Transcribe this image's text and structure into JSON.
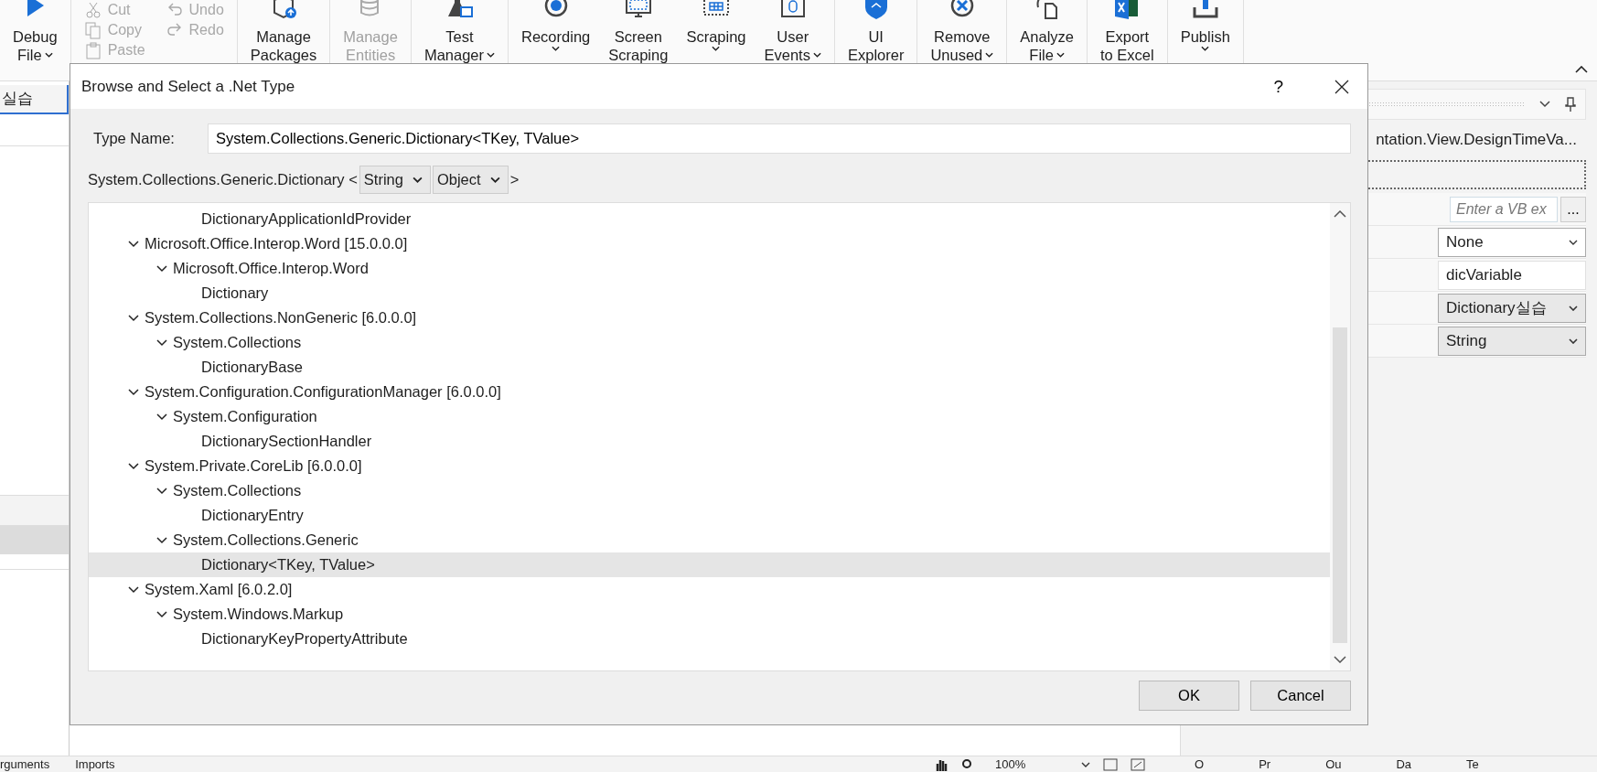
{
  "ribbon": {
    "groups": [
      {
        "kind": "buttons",
        "buttons": [
          {
            "lines": [
              "Debug",
              "File"
            ],
            "dropdown": true,
            "disabled": false
          }
        ]
      },
      {
        "kind": "clipboard",
        "items": [
          {
            "label": "Cut",
            "disabled": true
          },
          {
            "label": "Undo",
            "disabled": true
          },
          {
            "label": "Copy",
            "disabled": true
          },
          {
            "label": "Redo",
            "disabled": true
          },
          {
            "label": "Paste",
            "disabled": true
          }
        ]
      },
      {
        "kind": "buttons",
        "buttons": [
          {
            "lines": [
              "Manage",
              "Packages"
            ],
            "dropdown": false,
            "disabled": false
          }
        ]
      },
      {
        "kind": "buttons",
        "buttons": [
          {
            "lines": [
              "Manage",
              "Entities"
            ],
            "dropdown": false,
            "disabled": true
          }
        ]
      },
      {
        "kind": "buttons",
        "buttons": [
          {
            "lines": [
              "Test",
              "Manager"
            ],
            "dropdown": true,
            "disabled": false
          }
        ]
      },
      {
        "kind": "buttons",
        "buttons": [
          {
            "lines": [
              "Recording"
            ],
            "dropdown": true,
            "disabled": false
          },
          {
            "lines": [
              "Screen",
              "Scraping"
            ],
            "dropdown": false,
            "disabled": false
          },
          {
            "lines": [
              "Scraping"
            ],
            "dropdown": true,
            "disabled": false
          },
          {
            "lines": [
              "User",
              "Events"
            ],
            "dropdown": true,
            "disabled": false
          }
        ]
      },
      {
        "kind": "buttons",
        "buttons": [
          {
            "lines": [
              "UI",
              "Explorer"
            ],
            "dropdown": false,
            "disabled": false
          }
        ]
      },
      {
        "kind": "buttons",
        "buttons": [
          {
            "lines": [
              "Remove",
              "Unused"
            ],
            "dropdown": true,
            "disabled": false
          }
        ]
      },
      {
        "kind": "buttons",
        "buttons": [
          {
            "lines": [
              "Analyze",
              "File"
            ],
            "dropdown": true,
            "disabled": false
          }
        ]
      },
      {
        "kind": "buttons",
        "buttons": [
          {
            "lines": [
              "Export",
              "to Excel"
            ],
            "dropdown": false,
            "disabled": false
          }
        ]
      },
      {
        "kind": "buttons",
        "buttons": [
          {
            "lines": [
              "Publish"
            ],
            "dropdown": true,
            "disabled": false
          }
        ]
      }
    ]
  },
  "left_panel": {
    "tab": {
      "label": "실습",
      "selected": true
    }
  },
  "properties_panel": {
    "title": "ntation.View.DesignTimeVa...",
    "rows": [
      {
        "kind": "expression",
        "placeholder": "Enter a VB ex",
        "button": "..."
      },
      {
        "kind": "select",
        "value": "None"
      },
      {
        "kind": "text",
        "value": "dicVariable"
      },
      {
        "kind": "combo",
        "value": "Dictionary실습"
      },
      {
        "kind": "combo",
        "value": "String"
      }
    ]
  },
  "status_bar": {
    "tabs": [
      "rguments",
      "Imports"
    ],
    "zoom": "100%",
    "panel_tabs": [
      "O",
      "Pr",
      "Ou",
      "Da",
      "Te"
    ]
  },
  "dialog": {
    "title": "Browse and Select a .Net Type",
    "help": "?",
    "type_name": {
      "label": "Type Name:",
      "value": "System.Collections.Generic.Dictionary<TKey, TValue>"
    },
    "generic": {
      "prefix": "System.Collections.Generic.Dictionary <",
      "args": [
        "String",
        "Object"
      ],
      "suffix": ">"
    },
    "tree": [
      {
        "children": [
          {
            "children": [
              {
                "label": "DictionaryApplicationIdProvider",
                "selected": false
              }
            ]
          }
        ]
      },
      {
        "label": "Microsoft.Office.Interop.Word [15.0.0.0]",
        "expanded": true,
        "selected": false,
        "children": [
          {
            "label": "Microsoft.Office.Interop.Word",
            "expanded": true,
            "selected": false,
            "children": [
              {
                "label": "Dictionary",
                "selected": false
              }
            ]
          }
        ]
      },
      {
        "label": "System.Collections.NonGeneric [6.0.0.0]",
        "expanded": true,
        "selected": false,
        "children": [
          {
            "label": "System.Collections",
            "expanded": true,
            "selected": false,
            "children": [
              {
                "label": "DictionaryBase",
                "selected": false
              }
            ]
          }
        ]
      },
      {
        "label": "System.Configuration.ConfigurationManager [6.0.0.0]",
        "expanded": true,
        "selected": false,
        "children": [
          {
            "label": "System.Configuration",
            "expanded": true,
            "selected": false,
            "children": [
              {
                "label": "DictionarySectionHandler",
                "selected": false
              }
            ]
          }
        ]
      },
      {
        "label": "System.Private.CoreLib [6.0.0.0]",
        "expanded": true,
        "selected": false,
        "children": [
          {
            "label": "System.Collections",
            "expanded": true,
            "selected": false,
            "children": [
              {
                "label": "DictionaryEntry",
                "selected": false
              }
            ]
          },
          {
            "label": "System.Collections.Generic",
            "expanded": true,
            "selected": false,
            "children": [
              {
                "label": "Dictionary<TKey, TValue>",
                "selected": true
              }
            ]
          }
        ]
      },
      {
        "label": "System.Xaml [6.0.2.0]",
        "expanded": true,
        "selected": false,
        "children": [
          {
            "label": "System.Windows.Markup",
            "expanded": true,
            "selected": false,
            "children": [
              {
                "label": "DictionaryKeyPropertyAttribute",
                "selected": false
              }
            ]
          }
        ]
      }
    ],
    "buttons": [
      "OK",
      "Cancel"
    ]
  }
}
